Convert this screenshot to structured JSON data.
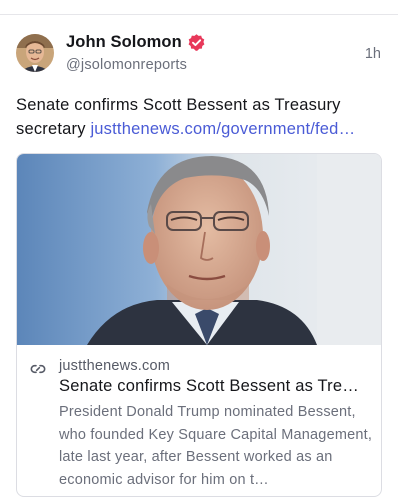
{
  "post": {
    "author": {
      "name": "John Solomon",
      "handle": "@jsolomonreports",
      "verified_icon": "verified-badge-icon",
      "verified_color": "#e8385a"
    },
    "timestamp": "1h",
    "text": "Senate confirms Scott Bessent as Treasury secretary ",
    "link": "justthenews.com/government/fed…",
    "link_color": "#4a5bd6",
    "card": {
      "domain": "justthenews.com",
      "title": "Senate confirms Scott Bessent as Tre…",
      "description": "President Donald Trump nominated Bessent, who founded Key Square Capital Management, late last year, after Bessent worked as an economic advisor for him on t…",
      "link_icon": "link-icon"
    }
  }
}
